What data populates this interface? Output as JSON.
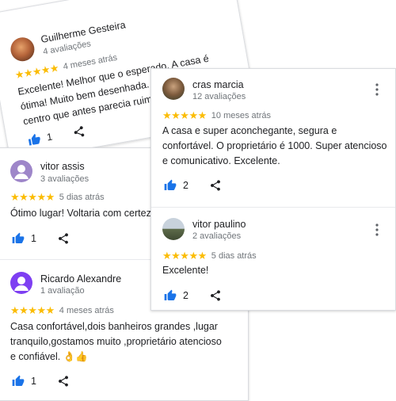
{
  "reviews": [
    {
      "name": "Guilherme Gesteira",
      "count": "4 avaliações",
      "stars": "★★★★★",
      "date": "4 meses atrás",
      "text": "Excelente! Melhor que o esperado. A casa é ótima! Muito bem desenhada. A distância do centro que antes parecia ruim, tornou-se excelente na hora de...",
      "likes": "1"
    },
    {
      "name": "cras marcia",
      "count": "12 avaliações",
      "stars": "★★★★★",
      "date": "10 meses atrás",
      "text": "A casa e super aconchegante, segura e confortável. O proprietário é 1000. Super atencioso e comunicativo. Excelente.",
      "likes": "2"
    },
    {
      "name": "vitor assis",
      "count": "3 avaliações",
      "stars": "★★★★★",
      "date": "5 dias atrás",
      "text": "Ótimo lugar! Voltaria com certeza!",
      "likes": "1"
    },
    {
      "name": "vitor paulino",
      "count": "2 avaliações",
      "stars": "★★★★★",
      "date": "5 dias atrás",
      "text": "Excelente!",
      "likes": "2"
    },
    {
      "name": "Ricardo Alexandre",
      "count": "1 avaliação",
      "stars": "★★★★★",
      "date": "4 meses atrás",
      "text": "Casa confortável,dois banheiros grandes ,lugar tranquilo,gostamos muito ,proprietário atencioso e confiável. 👌👍",
      "likes": "1"
    }
  ],
  "colors": {
    "star": "#fbbc04",
    "icon": "#1a73e8",
    "avatar_purple": "#7e3ff2",
    "avatar_lilac": "#9e86c9"
  }
}
